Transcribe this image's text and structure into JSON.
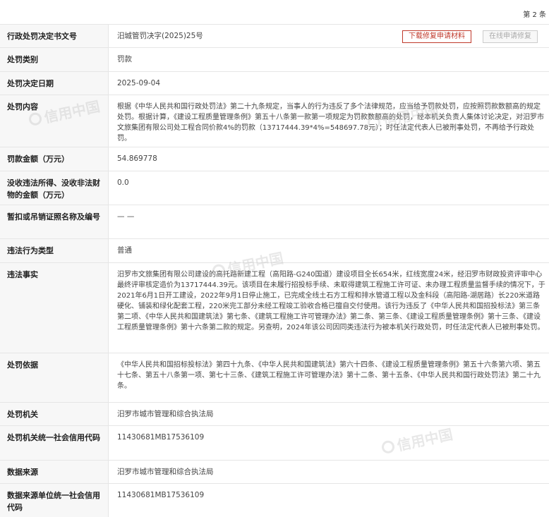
{
  "page_note": "第 2 条",
  "buttons": {
    "download": "下载修复申请材料",
    "online": "在线申请修复"
  },
  "watermark_text": "信用中国",
  "rows": [
    {
      "label": "行政处罚决定书文号",
      "value": "汨城管罚决字(2025)25号"
    },
    {
      "label": "处罚类别",
      "value": "罚款"
    },
    {
      "label": "处罚决定日期",
      "value": "2025-09-04"
    },
    {
      "label": "处罚内容",
      "value": "根据《中华人民共和国行政处罚法》第二十九条规定，当事人的行为违反了多个法律规范，应当给予罚款处罚，应按照罚款数额高的规定处罚。根据计算，《建设工程质量管理条例》第五十八条第一款第一项规定为罚款数额高的处罚，经本机关负责人集体讨论决定，对汨罗市文旅集团有限公司处工程合同价款4%的罚款（13717444.39*4%=548697.78元）；时任法定代表人已被刑事处罚，不再给予行政处罚。"
    },
    {
      "label": "罚款金额（万元）",
      "value": "54.869778"
    },
    {
      "label": "没收违法所得、没收非法财物的金额（万元）",
      "value": "0.0"
    },
    {
      "label": "暂扣或吊销证照名称及编号",
      "value": "— —"
    },
    {
      "label": "违法行为类型",
      "value": "普通"
    },
    {
      "label": "违法事实",
      "value": "汨罗市文旅集团有限公司建设的高托路新建工程（高阳路-G240国道）建设项目全长654米，红线宽度24米，经汨罗市财政投资评审中心最终评审核定造价为13717444.39元。该项目在未履行招投标手续、未取得建筑工程施工许可证、未办理工程质量监督手续的情况下，于2021年6月1日开工建设，2022年9月1日停止施工，已完成全线土石方工程和排水管道工程以及金科段（高阳路-湖居路）长220米道路硬化、铺装和绿化配套工程，220米完工部分未经工程竣工验收合格已擅自交付使用。该行为违反了《中华人民共和国招投标法》第三条第二项、《中华人民共和国建筑法》第七条、《建筑工程施工许可管理办法》第二条、第三条、《建设工程质量管理条例》第十三条、《建设工程质量管理条例》第十六条第二款的规定。另查明，2024年该公司因同类违法行为被本机关行政处罚，时任法定代表人已被刑事处罚。"
    },
    {
      "label": "处罚依据",
      "value": "《中华人民共和国招标投标法》第四十九条、《中华人民共和国建筑法》第六十四条、《建设工程质量管理条例》第五十六条第六项、第五十七条、第五十八条第一项、第七十三条、《建筑工程施工许可管理办法》第十二条、第十五条、《中华人民共和国行政处罚法》第二十九条。"
    },
    {
      "label": "处罚机关",
      "value": "汨罗市城市管理和综合执法局"
    },
    {
      "label": "处罚机关统一社会信用代码",
      "value": "11430681MB17536109"
    },
    {
      "label": "数据来源",
      "value": "汨罗市城市管理和综合执法局"
    },
    {
      "label": "数据来源单位统一社会信用代码",
      "value": "11430681MB17536109"
    }
  ]
}
